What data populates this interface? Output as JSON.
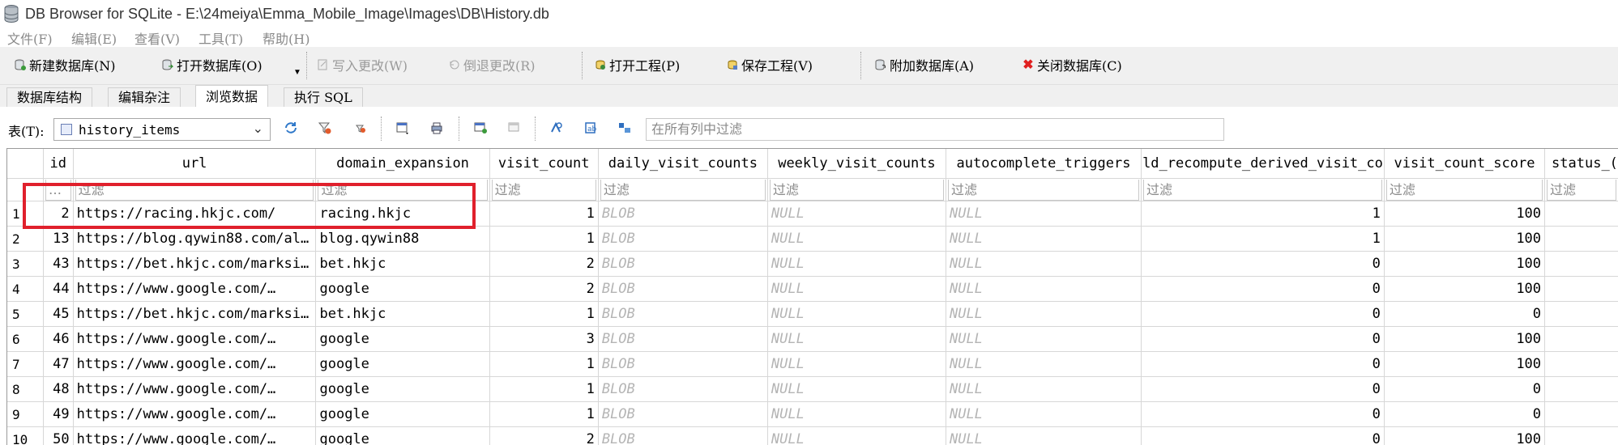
{
  "window": {
    "title": "DB Browser for SQLite - E:\\24meiya\\Emma_Mobile_Image\\Images\\DB\\History.db"
  },
  "menu": [
    "文件(F)",
    "编辑(E)",
    "查看(V)",
    "工具(T)",
    "帮助(H)"
  ],
  "toolbar": {
    "new_db": "新建数据库(N)",
    "open_db": "打开数据库(O)",
    "write_changes": "写入更改(W)",
    "revert_changes": "倒退更改(R)",
    "open_project": "打开工程(P)",
    "save_project": "保存工程(V)",
    "attach_db": "附加数据库(A)",
    "close_db": "关闭数据库(C)"
  },
  "tabs": [
    "数据库结构",
    "编辑杂注",
    "浏览数据",
    "执行 SQL"
  ],
  "browse": {
    "table_label": "表(T):",
    "table_selected": "history_items",
    "filter_all_placeholder": "在所有列中过滤"
  },
  "grid": {
    "columns": [
      "id",
      "url",
      "domain_expansion",
      "visit_count",
      "daily_visit_counts",
      "weekly_visit_counts",
      "autocomplete_triggers",
      "ld_recompute_derived_visit_co",
      "visit_count_score",
      "status_("
    ],
    "filter_placeholder": "过滤",
    "id_filter_text": "…",
    "rows": [
      {
        "row": "1",
        "id": "2",
        "url": "https://racing.hkjc.com/",
        "domain": "racing.hkjc",
        "visit_count": "1",
        "daily": "BLOB",
        "weekly": "NULL",
        "autocomplete": "NULL",
        "recompute": "1",
        "score": "100"
      },
      {
        "row": "2",
        "id": "13",
        "url": "https://blog.qywin88.com/al…",
        "domain": "blog.qywin88",
        "visit_count": "1",
        "daily": "BLOB",
        "weekly": "NULL",
        "autocomplete": "NULL",
        "recompute": "1",
        "score": "100"
      },
      {
        "row": "3",
        "id": "43",
        "url": "https://bet.hkjc.com/marksi…",
        "domain": "bet.hkjc",
        "visit_count": "2",
        "daily": "BLOB",
        "weekly": "NULL",
        "autocomplete": "NULL",
        "recompute": "0",
        "score": "100"
      },
      {
        "row": "4",
        "id": "44",
        "url": "https://www.google.com/…",
        "domain": "google",
        "visit_count": "2",
        "daily": "BLOB",
        "weekly": "NULL",
        "autocomplete": "NULL",
        "recompute": "0",
        "score": "100"
      },
      {
        "row": "5",
        "id": "45",
        "url": "https://bet.hkjc.com/marksi…",
        "domain": "bet.hkjc",
        "visit_count": "1",
        "daily": "BLOB",
        "weekly": "NULL",
        "autocomplete": "NULL",
        "recompute": "0",
        "score": "0"
      },
      {
        "row": "6",
        "id": "46",
        "url": "https://www.google.com/…",
        "domain": "google",
        "visit_count": "3",
        "daily": "BLOB",
        "weekly": "NULL",
        "autocomplete": "NULL",
        "recompute": "0",
        "score": "100"
      },
      {
        "row": "7",
        "id": "47",
        "url": "https://www.google.com/…",
        "domain": "google",
        "visit_count": "1",
        "daily": "BLOB",
        "weekly": "NULL",
        "autocomplete": "NULL",
        "recompute": "0",
        "score": "100"
      },
      {
        "row": "8",
        "id": "48",
        "url": "https://www.google.com/…",
        "domain": "google",
        "visit_count": "1",
        "daily": "BLOB",
        "weekly": "NULL",
        "autocomplete": "NULL",
        "recompute": "0",
        "score": "0"
      },
      {
        "row": "9",
        "id": "49",
        "url": "https://www.google.com/…",
        "domain": "google",
        "visit_count": "1",
        "daily": "BLOB",
        "weekly": "NULL",
        "autocomplete": "NULL",
        "recompute": "0",
        "score": "0"
      },
      {
        "row": "10",
        "id": "50",
        "url": "https://www.google.com/…",
        "domain": "google",
        "visit_count": "2",
        "daily": "BLOB",
        "weekly": "NULL",
        "autocomplete": "NULL",
        "recompute": "0",
        "score": "100"
      }
    ]
  },
  "colors": {
    "highlight": "#e0202c",
    "null_text": "#b4b4b4",
    "toolbar_bg": "#f0f0f0",
    "close_icon": "#e02020"
  },
  "icons": [
    "database-icon",
    "new-db-icon",
    "open-db-icon",
    "write-icon",
    "revert-icon",
    "open-project-icon",
    "save-project-icon",
    "attach-db-icon",
    "close-db-icon",
    "refresh-icon",
    "clear-filter-icon",
    "delete-filter-icon",
    "save-table-icon",
    "print-icon",
    "insert-record-icon",
    "delete-record-icon",
    "find-icon",
    "replace-icon",
    "set-encoding-icon"
  ]
}
